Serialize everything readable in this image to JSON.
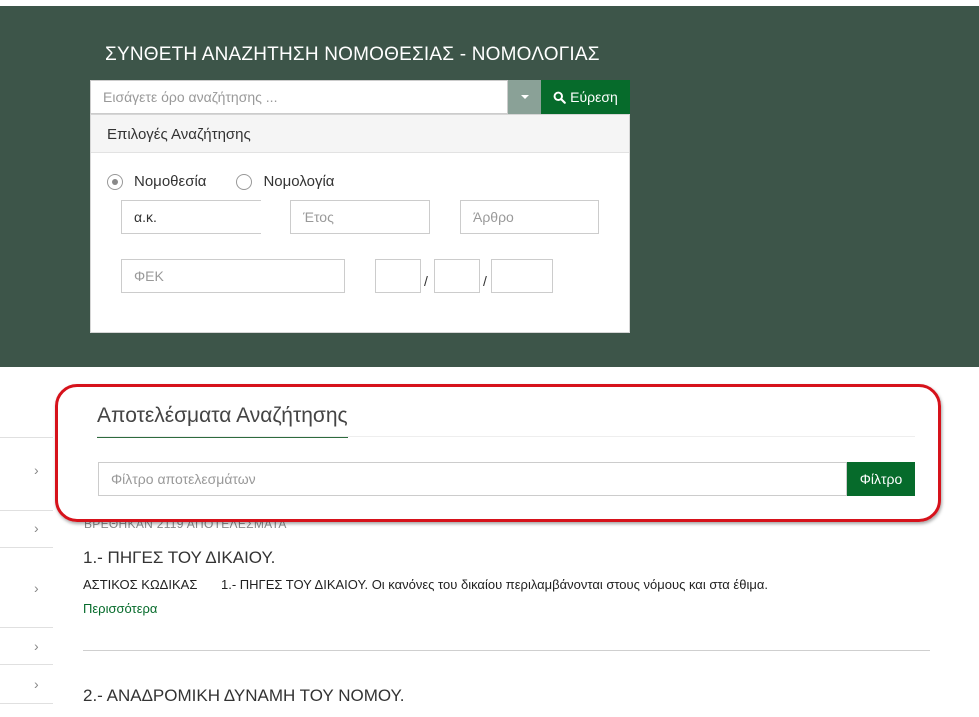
{
  "header": {
    "title": "ΣΥΝΘΕΤΗ ΑΝΑΖΗΤΗΣΗ ΝΟΜΟΘΕΣΙΑΣ - ΝΟΜΟΛΟΓΙΑΣ"
  },
  "search": {
    "placeholder": "Εισάγετε όρο αναζήτησης ...",
    "find_label": "Εύρεση",
    "find_icon": "search-icon",
    "dropdown_icon": "caret-down-icon"
  },
  "options": {
    "title": "Επιλογές Αναζήτησης",
    "radios": [
      {
        "label": "Νομοθεσία",
        "checked": true
      },
      {
        "label": "Νομολογία",
        "checked": false
      }
    ],
    "code_value": "α.κ.",
    "year_placeholder": "Έτος",
    "article_placeholder": "Άρθρο",
    "fek_placeholder": "ΦΕΚ",
    "slash": "/"
  },
  "results": {
    "title": "Αποτελέσματα Αναζήτησης",
    "filter_placeholder": "Φίλτρο αποτελεσμάτων",
    "filter_button": "Φίλτρο",
    "count_text": "ΒΡΕΘΗΚΑΝ 2119 ΑΠΟΤΕΛΕΣΜΑΤΑ",
    "items": [
      {
        "title": "1.- ΠΗΓΕΣ ΤΟΥ ΔΙΚΑΙΟΥ.",
        "code": "ΑΣΤΙΚΟΣ ΚΩΔΙΚΑΣ",
        "snippet": "1.- ΠΗΓΕΣ ΤΟΥ ΔΙΚΑΙΟΥ. Οι κανόνες του δικαίου περιλαμβάνονται στους νόμους και στα έθιμα.",
        "more": "Περισσότερα"
      },
      {
        "title": "2.- ΑΝΑΔΡΟΜΙΚΗ ΔΥΝΑΜΗ ΤΟΥ ΝΟΜΟΥ."
      }
    ]
  },
  "sidebar": {
    "chevron": "›"
  },
  "colors": {
    "header_bg": "#3d5549",
    "brand_green": "#066b2b",
    "highlight_red": "#d6121b"
  }
}
